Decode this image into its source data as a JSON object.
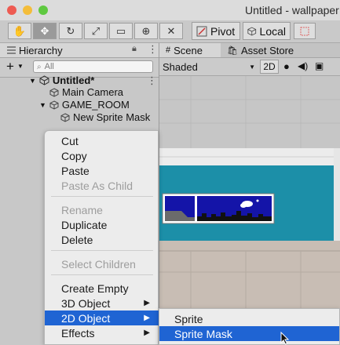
{
  "window": {
    "title": "Untitled - wallpaper"
  },
  "toolbar": {
    "tools": [
      {
        "name": "hand-tool",
        "glyph": "✋"
      },
      {
        "name": "move-tool",
        "glyph": "✥"
      },
      {
        "name": "rotate-tool",
        "glyph": "↻"
      },
      {
        "name": "scale-tool",
        "glyph": "⤢"
      },
      {
        "name": "rect-tool",
        "glyph": "▭"
      },
      {
        "name": "transform-tool",
        "glyph": "⊕"
      },
      {
        "name": "custom-tool",
        "glyph": "✕"
      }
    ],
    "pivot_label": "Pivot",
    "local_label": "Local"
  },
  "hierarchy": {
    "tab_label": "Hierarchy",
    "search_placeholder": "All",
    "add_glyph": "+",
    "scene_name": "Untitled*",
    "items": [
      {
        "label": "Main Camera"
      },
      {
        "label": "GAME_ROOM"
      },
      {
        "label": "New Sprite Mask"
      }
    ]
  },
  "scene": {
    "tabs": [
      {
        "label": "Scene"
      },
      {
        "label": "Asset Store"
      }
    ],
    "shading_mode": "Shaded",
    "mode_2d": "2D"
  },
  "context_menu": {
    "items": [
      "Cut",
      "Copy",
      "Paste",
      "Paste As Child",
      "Rename",
      "Duplicate",
      "Delete",
      "Select Children",
      "Create Empty",
      "3D Object",
      "2D Object",
      "Effects"
    ]
  },
  "submenu": {
    "items": [
      "Sprite",
      "Sprite Mask"
    ]
  },
  "colors": {
    "selection": "#1f64d3",
    "room_wall": "#1c8fa8",
    "sky": "#1414a8",
    "traffic_red": "#ee5b52",
    "traffic_yellow": "#f4bd3a",
    "traffic_green": "#5fc940"
  }
}
